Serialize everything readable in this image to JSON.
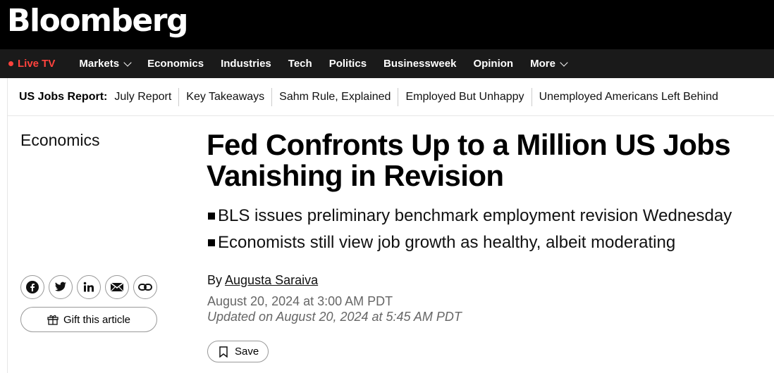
{
  "brand": {
    "logo": "Bloomberg"
  },
  "nav": {
    "live_tv": "Live TV",
    "items": [
      "Markets",
      "Economics",
      "Industries",
      "Tech",
      "Politics",
      "Businessweek",
      "Opinion",
      "More"
    ]
  },
  "subnav": {
    "label": "US Jobs Report:",
    "links": [
      "July Report",
      "Key Takeaways",
      "Sahm Rule, Explained",
      "Employed But Unhappy",
      "Unemployed Americans Left Behind"
    ]
  },
  "article": {
    "section": "Economics",
    "headline": "Fed Confronts Up to a Million US Jobs Vanishing in Revision",
    "bullets": [
      "BLS issues preliminary benchmark employment revision Wednesday",
      "Economists still view job growth as healthy, albeit moderating"
    ],
    "byline_prefix": "By",
    "author": "Augusta Saraiva",
    "published": "August 20, 2024 at 3:00 AM PDT",
    "updated": "Updated on August 20, 2024 at 5:45 AM PDT",
    "save_label": "Save"
  },
  "share": {
    "icons": [
      "facebook-icon",
      "x-twitter-icon",
      "linkedin-icon",
      "email-icon",
      "link-icon"
    ],
    "gift_label": "Gift this article"
  },
  "colors": {
    "live": "#ff433d",
    "topbar": "#000000",
    "nav": "#1a1a1a"
  }
}
